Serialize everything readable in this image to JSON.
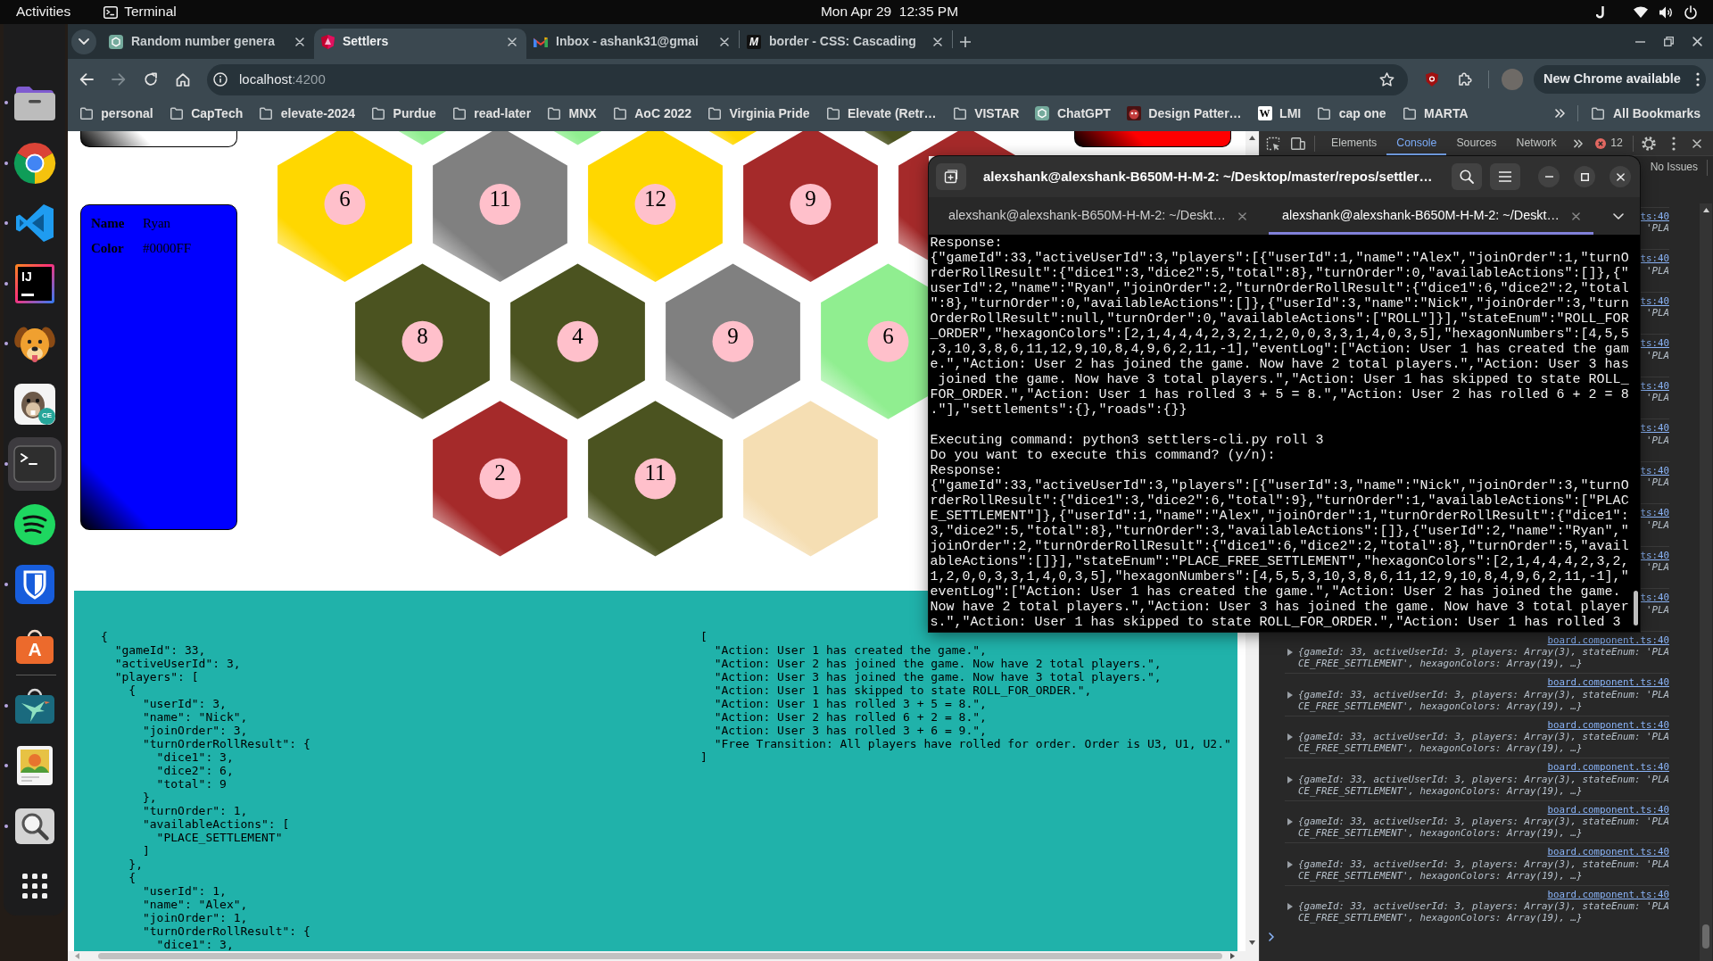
{
  "top_bar": {
    "activities": "Activities",
    "app_name": "Terminal",
    "clock": "Mon Apr 29  12:35 PM"
  },
  "dock": {
    "pinned": [
      {
        "kind": "folder",
        "running": true,
        "active": false
      },
      {
        "kind": "browser",
        "running": true,
        "active": false
      },
      {
        "kind": "ribbon",
        "running": true,
        "active": false
      },
      {
        "kind": "letter-tile",
        "label": "IJ",
        "running": true,
        "active": false
      },
      {
        "kind": "dog",
        "running": true,
        "active": false
      },
      {
        "kind": "beaver",
        "label": "CE",
        "running": false,
        "active": false
      },
      {
        "kind": "terminal",
        "running": true,
        "active": true
      },
      {
        "kind": "music",
        "running": false,
        "active": false
      },
      {
        "kind": "shield",
        "running": true,
        "active": false
      },
      {
        "kind": "bag",
        "label": "A",
        "running": false,
        "active": false
      }
    ],
    "unpinned": [
      {
        "kind": "bird",
        "running": true,
        "active": false
      },
      {
        "kind": "picture",
        "running": true,
        "active": false
      },
      {
        "kind": "magnifier",
        "running": true,
        "active": false
      },
      {
        "kind": "grid",
        "running": false,
        "active": false
      }
    ]
  },
  "browser": {
    "tabs": [
      {
        "kind": "knot",
        "title": "Random number genera",
        "selected": false
      },
      {
        "kind": "shield",
        "title": "Settlers",
        "selected": true
      },
      {
        "kind": "mail",
        "title": "Inbox - ashank31@gmai",
        "selected": false
      },
      {
        "kind": "dark-letter-tile",
        "icon_text": "M",
        "title": "border - CSS: Cascading",
        "selected": false
      }
    ],
    "nav": {
      "forward_disabled": true
    },
    "address": {
      "host": "localhost",
      "port": ":4200"
    },
    "update_button": "New Chrome available",
    "bookmarks": [
      {
        "kind": "folder",
        "label": "personal"
      },
      {
        "kind": "folder",
        "label": "CapTech"
      },
      {
        "kind": "folder",
        "label": "elevate-2024"
      },
      {
        "kind": "folder",
        "label": "Purdue"
      },
      {
        "kind": "folder",
        "label": "read-later"
      },
      {
        "kind": "folder",
        "label": "MNX"
      },
      {
        "kind": "folder",
        "label": "AoC 2022"
      },
      {
        "kind": "folder",
        "label": "Virginia Pride"
      },
      {
        "kind": "folder",
        "label": "Elevate (Retr…"
      },
      {
        "kind": "folder",
        "label": "VISTAR"
      },
      {
        "kind": "knot",
        "label": "ChatGPT"
      },
      {
        "kind": "mascot",
        "label": "Design Patter…"
      },
      {
        "kind": "light-letter-tile",
        "icon_text": "W",
        "label": "LMI"
      },
      {
        "kind": "folder",
        "label": "cap one"
      },
      {
        "kind": "folder",
        "label": "MARTA"
      }
    ],
    "all_bookmarks": "All Bookmarks"
  },
  "page": {
    "left_cards": [
      {
        "kind": "cut-off",
        "color": "#ffffff"
      },
      {
        "kind": "full",
        "color": "#0000ff",
        "fields": [
          {
            "label": "Name",
            "value": "Ryan"
          },
          {
            "label": "Color",
            "value": "#0000FF"
          }
        ]
      }
    ],
    "board": {
      "rows": [
        [
          {
            "color": "#90ee90"
          },
          {
            "color": "#90ee90"
          },
          {
            "color": "#ffd700"
          },
          {
            "color": "#4b5320"
          }
        ],
        [
          {
            "color": "#ffd700",
            "number": "6"
          },
          {
            "color": "#808080",
            "number": "11"
          },
          {
            "color": "#ffd700",
            "number": "12"
          },
          {
            "color": "#a52a2a",
            "number": "9"
          },
          {
            "color": "#a52a2a"
          }
        ],
        [
          {
            "color": "#4b5320",
            "number": "8"
          },
          {
            "color": "#4b5320",
            "number": "4"
          },
          {
            "color": "#808080",
            "number": "9"
          },
          {
            "color": "#90ee90",
            "number": "6"
          }
        ],
        [
          {
            "color": "#a52a2a",
            "number": "2"
          },
          {
            "color": "#4b5320",
            "number": "11"
          },
          {
            "color": "#f5deb3"
          }
        ]
      ]
    },
    "right_cards": [
      {
        "kind": "cut-off",
        "color": "#ff0000"
      }
    ],
    "state_json": [
      "{",
      "  \"gameId\": 33,",
      "  \"activeUserId\": 3,",
      "  \"players\": [",
      "    {",
      "      \"userId\": 3,",
      "      \"name\": \"Nick\",",
      "      \"joinOrder\": 3,",
      "      \"turnOrderRollResult\": {",
      "        \"dice1\": 3,",
      "        \"dice2\": 6,",
      "        \"total\": 9",
      "      },",
      "      \"turnOrder\": 1,",
      "      \"availableActions\": [",
      "        \"PLACE_SETTLEMENT\"",
      "      ]",
      "    },",
      "    {",
      "      \"userId\": 1,",
      "      \"name\": \"Alex\",",
      "      \"joinOrder\": 1,",
      "      \"turnOrderRollResult\": {",
      "        \"dice1\": 3,"
    ],
    "event_log": [
      "[",
      "  \"Action: User 1 has created the game.\",",
      "  \"Action: User 2 has joined the game. Now have 2 total players.\",",
      "  \"Action: User 3 has joined the game. Now have 3 total players.\",",
      "  \"Action: User 1 has skipped to state ROLL_FOR_ORDER.\",",
      "  \"Action: User 1 has rolled 3 + 5 = 8.\",",
      "  \"Action: User 2 has rolled 6 + 2 = 8.\",",
      "  \"Action: User 3 has rolled 3 + 6 = 9.\",",
      "  \"Free Transition: All players have rolled for order. Order is U3, U1, U2.\"",
      "]"
    ]
  },
  "devtools": {
    "tabs": [
      {
        "label": "Elements",
        "selected": false
      },
      {
        "label": "Console",
        "selected": true
      },
      {
        "label": "Sources",
        "selected": false
      },
      {
        "label": "Network",
        "selected": false
      }
    ],
    "error_count": "12",
    "issues": "No Issues",
    "messages": [
      {
        "kind": "covered",
        "source": "ts:40",
        "preview": [
          "'PLA"
        ]
      },
      {
        "kind": "covered",
        "source": "ts:40",
        "preview": [
          "'PLA"
        ]
      },
      {
        "kind": "covered",
        "source": "ts:40",
        "preview": [
          "'PLA"
        ]
      },
      {
        "kind": "covered",
        "source": "ts:40",
        "preview": [
          "'PLA"
        ]
      },
      {
        "kind": "covered",
        "source": "ts:40",
        "preview": [
          "'PLA"
        ]
      },
      {
        "kind": "covered",
        "source": "ts:40",
        "preview": [
          "'PLA"
        ]
      },
      {
        "kind": "covered",
        "source": "ts:40",
        "preview": [
          "'PLA"
        ]
      },
      {
        "kind": "covered",
        "source": "ts:40",
        "preview": [
          "'PLA"
        ]
      },
      {
        "kind": "covered",
        "source": "ts:40",
        "preview": [
          "'PLA"
        ]
      },
      {
        "kind": "covered",
        "source": "ts:40",
        "preview": [
          "'PLA"
        ]
      },
      {
        "kind": "full",
        "source": "board.component.ts:40",
        "preview": [
          "{gameId: 33, activeUserId: 3, players: Array(3), stateEnum: 'PLA",
          "CE_FREE_SETTLEMENT', hexagonColors: Array(19), …}"
        ]
      },
      {
        "kind": "full",
        "source": "board.component.ts:40",
        "preview": [
          "{gameId: 33, activeUserId: 3, players: Array(3), stateEnum: 'PLA",
          "CE_FREE_SETTLEMENT', hexagonColors: Array(19), …}"
        ]
      },
      {
        "kind": "full",
        "source": "board.component.ts:40",
        "preview": [
          "{gameId: 33, activeUserId: 3, players: Array(3), stateEnum: 'PLA",
          "CE_FREE_SETTLEMENT', hexagonColors: Array(19), …}"
        ]
      },
      {
        "kind": "full",
        "source": "board.component.ts:40",
        "preview": [
          "{gameId: 33, activeUserId: 3, players: Array(3), stateEnum: 'PLA",
          "CE_FREE_SETTLEMENT', hexagonColors: Array(19), …}"
        ]
      },
      {
        "kind": "full",
        "source": "board.component.ts:40",
        "preview": [
          "{gameId: 33, activeUserId: 3, players: Array(3), stateEnum: 'PLA",
          "CE_FREE_SETTLEMENT', hexagonColors: Array(19), …}"
        ]
      },
      {
        "kind": "full",
        "source": "board.component.ts:40",
        "preview": [
          "{gameId: 33, activeUserId: 3, players: Array(3), stateEnum: 'PLA",
          "CE_FREE_SETTLEMENT', hexagonColors: Array(19), …}"
        ]
      },
      {
        "kind": "full",
        "source": "board.component.ts:40",
        "preview": [
          "{gameId: 33, activeUserId: 3, players: Array(3), stateEnum: 'PLA",
          "CE_FREE_SETTLEMENT', hexagonColors: Array(19), …}"
        ]
      }
    ]
  },
  "terminal": {
    "title": "alexshank@alexshank-B650M-H-M-2: ~/Desktop/master/repos/settler…",
    "tabs": [
      {
        "title": "alexshank@alexshank-B650M-H-M-2: ~/Deskt…",
        "selected": false
      },
      {
        "title": "alexshank@alexshank-B650M-H-M-2: ~/Deskt…",
        "selected": true
      }
    ],
    "output": [
      [
        "Response:",
        "{\"gameId\":33,\"activeUserId\":3,\"players\":[{\"userId\":1,\"name\":\"Alex\",\"joinOrder\":1,\"turnO",
        "rderRollResult\":{\"dice1\":3,\"dice2\":5,\"total\":8},\"turnOrder\":0,\"availableActions\":[]},{\"",
        "userId\":2,\"name\":\"Ryan\",\"joinOrder\":2,\"turnOrderRollResult\":{\"dice1\":6,\"dice2\":2,\"total",
        "\":8},\"turnOrder\":0,\"availableActions\":[]},{\"userId\":3,\"name\":\"Nick\",\"joinOrder\":3,\"turn",
        "OrderRollResult\":null,\"turnOrder\":0,\"availableActions\":[\"ROLL\"]}],\"stateEnum\":\"ROLL_FOR",
        "_ORDER\",\"hexagonColors\":[2,1,4,4,4,2,3,2,1,2,0,0,3,3,1,4,0,3,5],\"hexagonNumbers\":[4,5,5",
        ",3,10,3,8,6,11,12,9,10,8,4,9,6,2,11,-1],\"eventLog\":[\"Action: User 1 has created the gam",
        "e.\",\"Action: User 2 has joined the game. Now have 2 total players.\",\"Action: User 3 has",
        " joined the game. Now have 3 total players.\",\"Action: User 1 has skipped to state ROLL_",
        "FOR_ORDER.\",\"Action: User 1 has rolled 3 + 5 = 8.\",\"Action: User 2 has rolled 6 + 2 = 8",
        ".\"],\"settlements\":{},\"roads\":{}}"
      ],
      [
        "Executing command: python3 settlers-cli.py roll 3",
        "Do you want to execute this command? (y/n):",
        "Response:",
        "{\"gameId\":33,\"activeUserId\":3,\"players\":[{\"userId\":3,\"name\":\"Nick\",\"joinOrder\":3,\"turnO",
        "rderRollResult\":{\"dice1\":3,\"dice2\":6,\"total\":9},\"turnOrder\":1,\"availableActions\":[\"PLAC",
        "E_SETTLEMENT\"]},{\"userId\":1,\"name\":\"Alex\",\"joinOrder\":1,\"turnOrderRollResult\":{\"dice1\":",
        "3,\"dice2\":5,\"total\":8},\"turnOrder\":3,\"availableActions\":[]},{\"userId\":2,\"name\":\"Ryan\",\"",
        "joinOrder\":2,\"turnOrderRollResult\":{\"dice1\":6,\"dice2\":2,\"total\":8},\"turnOrder\":5,\"avail",
        "ableActions\":[]}],\"stateEnum\":\"PLACE_FREE_SETTLEMENT\",\"hexagonColors\":[2,1,4,4,4,2,3,2,",
        "1,2,0,0,3,3,1,4,0,3,5],\"hexagonNumbers\":[4,5,5,3,10,3,8,6,11,12,9,10,8,4,9,6,2,11,-1],\"",
        "eventLog\":[\"Action: User 1 has created the game.\",\"Action: User 2 has joined the game.",
        "Now have 2 total players.\",\"Action: User 3 has joined the game. Now have 3 total player",
        "s.\",\"Action: User 1 has skipped to state ROLL_FOR_ORDER.\",\"Action: User 1 has rolled 3"
      ]
    ]
  }
}
